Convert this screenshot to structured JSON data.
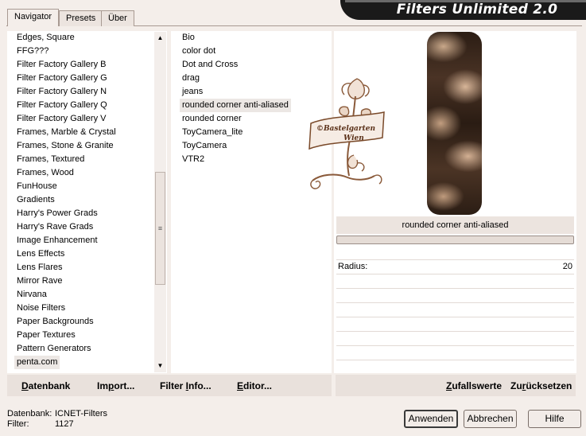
{
  "tabs": [
    {
      "label": "Navigator",
      "active": true
    },
    {
      "label": "Presets",
      "active": false
    },
    {
      "label": "Über",
      "active": false
    }
  ],
  "title": "Filters Unlimited 2.0",
  "categories": [
    "Edges, Square",
    "FFG???",
    "Filter Factory Gallery B",
    "Filter Factory Gallery G",
    "Filter Factory Gallery N",
    "Filter Factory Gallery Q",
    "Filter Factory Gallery V",
    "Frames, Marble & Crystal",
    "Frames, Stone & Granite",
    "Frames, Textured",
    "Frames, Wood",
    "FunHouse",
    "Gradients",
    "Harry's Power Grads",
    "Harry's Rave Grads",
    "Image Enhancement",
    "Lens Effects",
    "Lens Flares",
    "Mirror Rave",
    "Nirvana",
    "Noise Filters",
    "Paper Backgrounds",
    "Paper Textures",
    "Pattern Generators",
    "penta.com"
  ],
  "selected_category": "penta.com",
  "filters": [
    "Bio",
    "color dot",
    "Dot and Cross",
    "drag",
    "jeans",
    "rounded corner anti-aliased",
    "rounded corner",
    "ToyCamera_lite",
    "ToyCamera",
    "VTR2"
  ],
  "selected_filter": "rounded corner anti-aliased",
  "watermark": {
    "line1": "©Bastelgarten",
    "line2": "Wien"
  },
  "preview": {
    "filter_name": "rounded corner anti-aliased",
    "param_label": "Radius:",
    "param_value": "20"
  },
  "toolbar": {
    "database": {
      "pre": "",
      "u": "D",
      "post": "atenbank"
    },
    "import": {
      "pre": "Im",
      "u": "p",
      "post": "ort..."
    },
    "filter_info": {
      "pre": "Filter ",
      "u": "I",
      "post": "nfo..."
    },
    "editor": {
      "pre": "",
      "u": "E",
      "post": "ditor..."
    },
    "random": {
      "pre": "",
      "u": "Z",
      "post": "ufallswerte"
    },
    "reset": {
      "pre": "Zu",
      "u": "r",
      "post": "ücksetzen"
    }
  },
  "status": {
    "db_label": "Datenbank:",
    "db_value": "ICNET-Filters",
    "filter_label": "Filter:",
    "filter_value": "1127"
  },
  "buttons": {
    "apply": "Anwenden",
    "cancel": "Abbrechen",
    "help": "Hilfe"
  },
  "colors": {
    "accent_bg": "#f4eeea",
    "selection": "#ece7e4",
    "banner": "#1a1a1a"
  }
}
